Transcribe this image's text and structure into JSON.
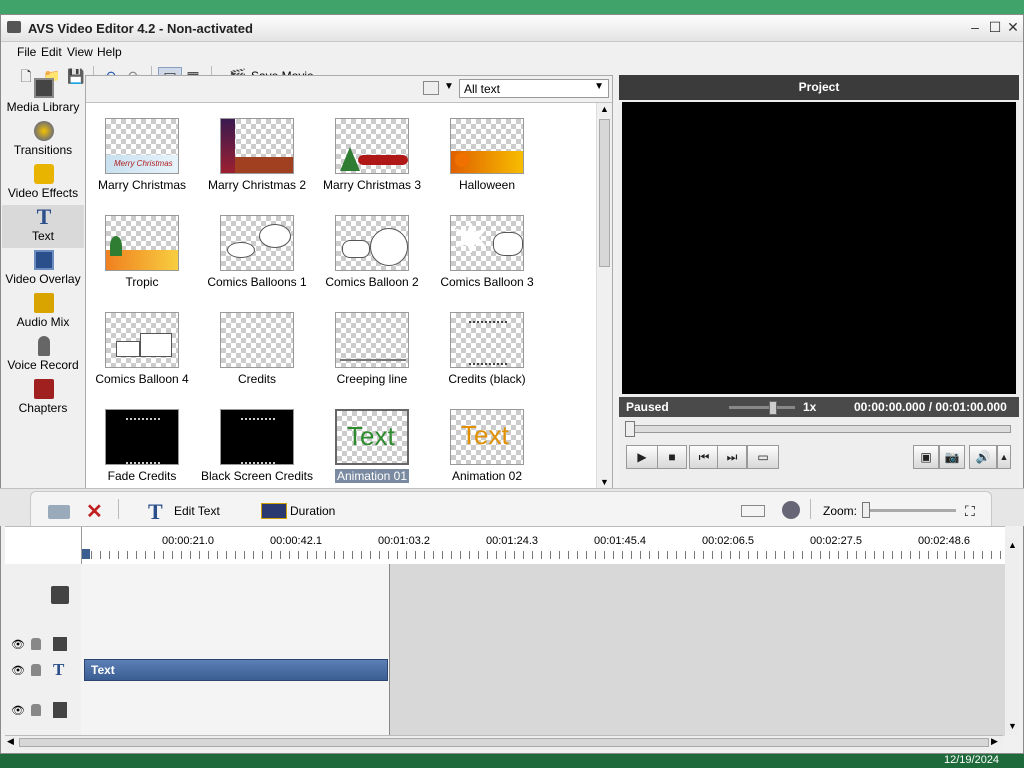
{
  "window": {
    "title": "AVS Video Editor 4.2 - Non-activated"
  },
  "menu": {
    "file": "File",
    "edit": "Edit",
    "view": "View",
    "help": "Help"
  },
  "toolbar": {
    "save_movie": "Save Movie..."
  },
  "nav": [
    {
      "label": "Media Library",
      "icon": "film-icon"
    },
    {
      "label": "Transitions",
      "icon": "transition-icon"
    },
    {
      "label": "Video Effects",
      "icon": "effects-icon"
    },
    {
      "label": "Text",
      "icon": "text-t-icon"
    },
    {
      "label": "Video Overlay",
      "icon": "overlay-icon"
    },
    {
      "label": "Audio Mix",
      "icon": "audio-icon"
    },
    {
      "label": "Voice Record",
      "icon": "microphone-icon"
    },
    {
      "label": "Chapters",
      "icon": "chapters-icon"
    }
  ],
  "library": {
    "filter": "All text",
    "items": [
      {
        "label": "Marry Christmas"
      },
      {
        "label": "Marry Christmas 2"
      },
      {
        "label": "Marry Christmas 3"
      },
      {
        "label": "Halloween"
      },
      {
        "label": "Tropic"
      },
      {
        "label": "Comics Balloons 1"
      },
      {
        "label": "Comics Balloon 2"
      },
      {
        "label": "Comics Balloon 3"
      },
      {
        "label": "Comics Balloon 4"
      },
      {
        "label": "Credits"
      },
      {
        "label": "Creeping line"
      },
      {
        "label": "Credits (black)"
      },
      {
        "label": "Fade Credits"
      },
      {
        "label": "Black Screen Credits"
      },
      {
        "label": "Animation 01"
      },
      {
        "label": "Animation 02"
      }
    ]
  },
  "project": {
    "title": "Project",
    "status": "Paused",
    "speed": "1x",
    "time": "00:00:00.000 / 00:01:00.000"
  },
  "timeline": {
    "edit_text": "Edit Text",
    "duration": "Duration",
    "zoom": "Zoom:",
    "ticks": [
      "00:00:21.0",
      "00:00:42.1",
      "00:01:03.2",
      "00:01:24.3",
      "00:01:45.4",
      "00:02:06.5",
      "00:02:27.5",
      "00:02:48.6"
    ],
    "text_clip": "Text"
  },
  "taskbar": {
    "date": "12/19/2024"
  }
}
